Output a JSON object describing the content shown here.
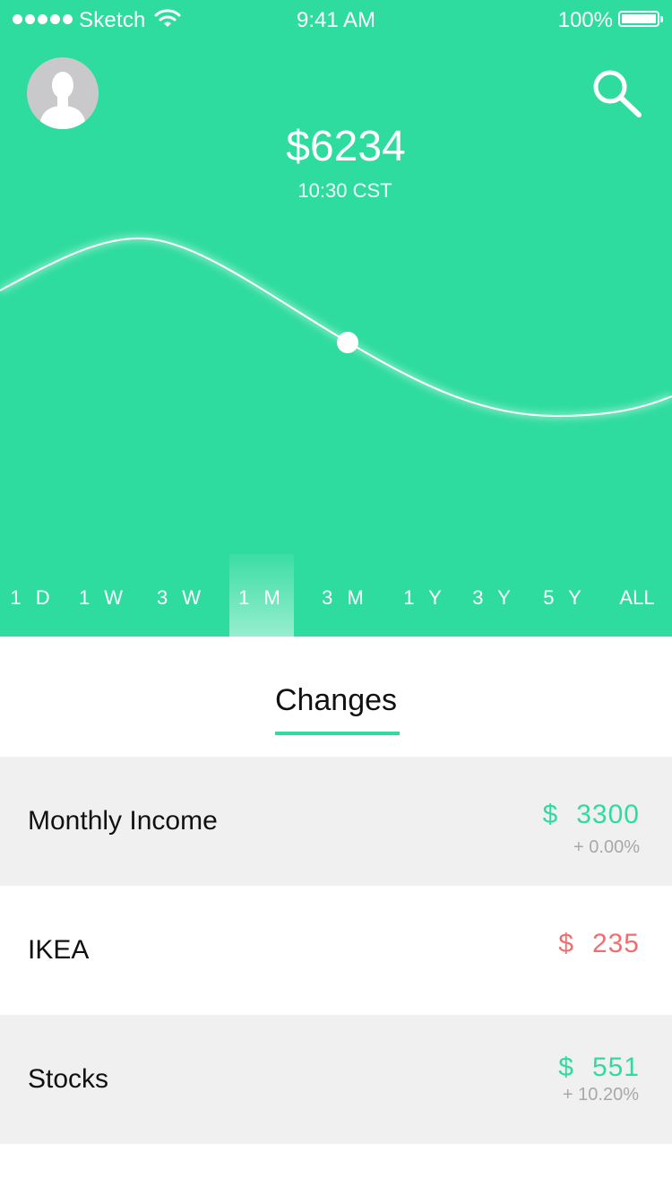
{
  "status_bar": {
    "carrier": "Sketch",
    "time": "9:41 AM",
    "battery": "100%"
  },
  "header": {
    "price": "$6234",
    "price_time": "10:30 CST"
  },
  "ranges": [
    {
      "label": "1 D",
      "active": false
    },
    {
      "label": "1 W",
      "active": false
    },
    {
      "label": "3 W",
      "active": false
    },
    {
      "label": "1 M",
      "active": true
    },
    {
      "label": "3 M",
      "active": false
    },
    {
      "label": "1 Y",
      "active": false
    },
    {
      "label": "3 Y",
      "active": false
    },
    {
      "label": "5 Y",
      "active": false
    },
    {
      "label": "ALL",
      "active": false
    }
  ],
  "tabs": {
    "changes_label": "Changes"
  },
  "rows": [
    {
      "name": "Monthly Income",
      "currency": "$",
      "amount": "3300",
      "change": "+ 0.00%",
      "tone": "green",
      "shaded": true
    },
    {
      "name": "IKEA",
      "currency": "$",
      "amount": "235",
      "change": "",
      "tone": "red",
      "shaded": false
    },
    {
      "name": "Stocks",
      "currency": "$",
      "amount": "551",
      "change": "+ 10.20%",
      "tone": "green",
      "shaded": true
    }
  ],
  "colors": {
    "accent": "#2fdc9f",
    "negative": "#f26e6e",
    "row_shade": "#f0f0f0"
  },
  "icons": {
    "avatar": "avatar-silhouette",
    "search": "search-icon",
    "wifi": "wifi-icon",
    "battery": "battery-icon"
  }
}
